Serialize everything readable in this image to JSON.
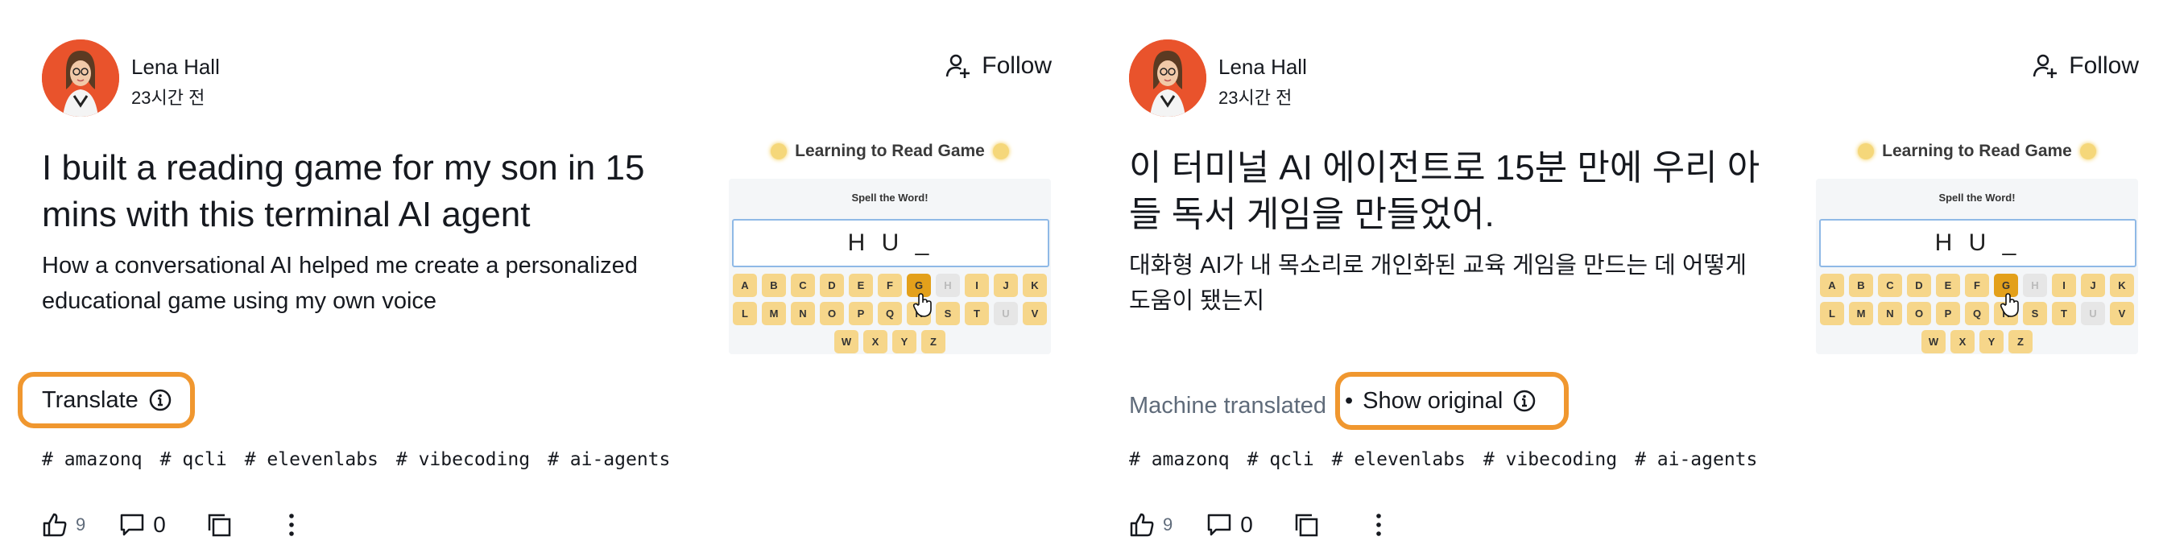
{
  "panels": [
    {
      "author": {
        "name": "Lena Hall",
        "time": "23시간 전"
      },
      "follow_label": "Follow",
      "title": "I built a reading game for my son in 15 mins with this terminal AI agent",
      "subtitle": "How a conversational AI helped me create a personalized educational game using my own voice",
      "translate_label": "Translate",
      "tags": [
        "# amazonq",
        "# qcli",
        "# elevenlabs",
        "# vibecoding",
        "# ai-agents"
      ],
      "likes": "9",
      "comments": "0"
    },
    {
      "author": {
        "name": "Lena Hall",
        "time": "23시간 전"
      },
      "follow_label": "Follow",
      "title": "이 터미널 AI 에이전트로 15분 만에 우리 아들 독서 게임을 만들었어.",
      "subtitle": "대화형 AI가 내 목소리로 개인화된 교육 게임을 만드는 데 어떻게 도움이 됐는지",
      "machine_translated": "Machine translated",
      "separator": "•",
      "show_original_label": "Show original",
      "tags": [
        "# amazonq",
        "# qcli",
        "# elevenlabs",
        "# vibecoding",
        "# ai-agents"
      ],
      "likes": "9",
      "comments": "0"
    }
  ],
  "game": {
    "title": "Learning to Read Game",
    "prompt": "Spell the Word!",
    "word": "H U _",
    "rows": [
      [
        "A",
        "B",
        "C",
        "D",
        "E",
        "F",
        "G",
        "H",
        "I",
        "J",
        "K"
      ],
      [
        "L",
        "M",
        "N",
        "O",
        "P",
        "Q",
        "R",
        "S",
        "T",
        "U",
        "V"
      ],
      [
        "W",
        "X",
        "Y",
        "Z"
      ]
    ],
    "active_key": "G",
    "disabled_keys": [
      "H",
      "U"
    ]
  },
  "colors": {
    "highlight": "#f0972f",
    "avatar_bg": "#e9532c",
    "key": "#f6d68a",
    "key_active": "#e3a01b"
  },
  "icons": [
    "follow-user-icon",
    "info-icon",
    "like-icon",
    "comment-icon",
    "copy-icon",
    "more-icon",
    "pointer-hand-icon"
  ]
}
